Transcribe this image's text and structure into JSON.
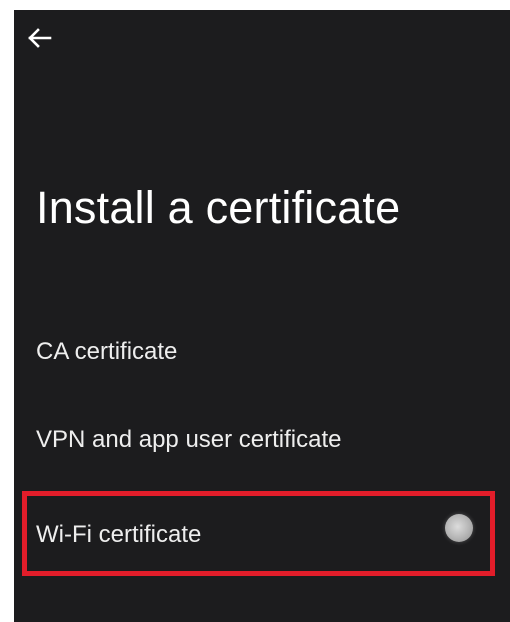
{
  "header": {
    "back_icon": "arrow-left-icon",
    "title": "Install a certificate"
  },
  "items": [
    {
      "label": "CA certificate"
    },
    {
      "label": "VPN and app user certificate"
    },
    {
      "label": "Wi-Fi certificate",
      "highlighted": true
    }
  ],
  "colors": {
    "background": "#1c1c1e",
    "text": "#ffffff",
    "highlight": "#e21d2a",
    "touch_indicator": "#b4b4b4"
  }
}
